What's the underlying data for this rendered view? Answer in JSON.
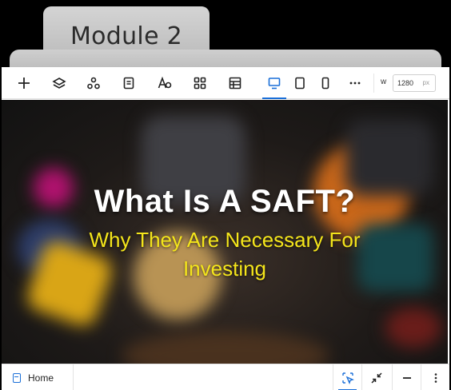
{
  "folder": {
    "tab_label": "Module 2"
  },
  "toolbar": {
    "buttons": [
      {
        "name": "add-icon",
        "active": false
      },
      {
        "name": "layers-icon",
        "active": false
      },
      {
        "name": "components-icon",
        "active": false
      },
      {
        "name": "pages-icon",
        "active": false
      },
      {
        "name": "typography-icon",
        "active": false
      },
      {
        "name": "apps-icon",
        "active": false
      },
      {
        "name": "table-icon",
        "active": false
      },
      {
        "name": "desktop-icon",
        "active": true
      },
      {
        "name": "tablet-icon",
        "active": false
      },
      {
        "name": "mobile-icon",
        "active": false
      },
      {
        "name": "more-icon",
        "active": false
      }
    ],
    "width_label": "w",
    "width_value": "1280",
    "width_unit": "px"
  },
  "canvas": {
    "title": "What Is A SAFT?",
    "subtitle": "Why They Are Necessary For Investing",
    "colors": {
      "title": "#ffffff",
      "subtitle": "#f4e51b"
    }
  },
  "bottombar": {
    "page_label": "Home",
    "buttons": [
      "select-icon",
      "collapse-icon",
      "minus-icon",
      "more-vertical-icon"
    ]
  },
  "accent": "#1a6fd8"
}
